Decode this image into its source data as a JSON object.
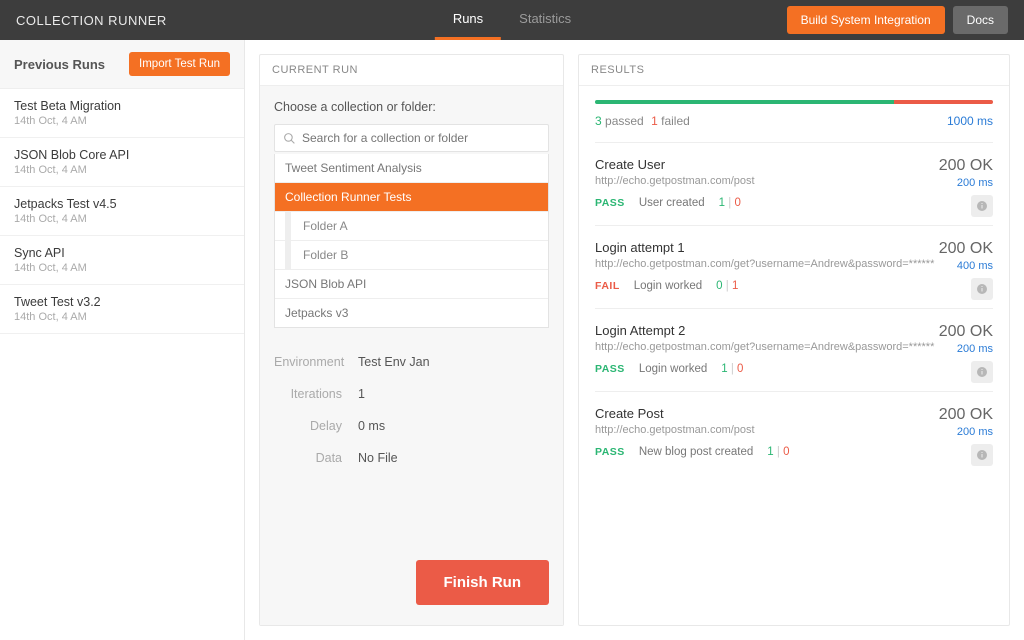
{
  "app_title": "COLLECTION RUNNER",
  "tabs": {
    "runs": "Runs",
    "statistics": "Statistics"
  },
  "header_buttons": {
    "build": "Build System Integration",
    "docs": "Docs"
  },
  "sidebar": {
    "title": "Previous Runs",
    "import_btn": "Import Test Run",
    "items": [
      {
        "name": "Test Beta Migration",
        "time": "14th Oct, 4 AM"
      },
      {
        "name": "JSON Blob Core API",
        "time": "14th Oct, 4 AM"
      },
      {
        "name": "Jetpacks Test v4.5",
        "time": "14th Oct, 4 AM"
      },
      {
        "name": "Sync API",
        "time": "14th Oct, 4 AM"
      },
      {
        "name": "Tweet Test v3.2",
        "time": "14th Oct, 4 AM"
      }
    ]
  },
  "current_run": {
    "panel_title": "CURRENT RUN",
    "prompt": "Choose a collection or folder:",
    "search_placeholder": "Search for a collection or folder",
    "collections": [
      {
        "label": "Tweet Sentiment Analysis",
        "type": "coll",
        "selected": false
      },
      {
        "label": "Collection Runner Tests",
        "type": "coll",
        "selected": true
      },
      {
        "label": "Folder A",
        "type": "folder",
        "selected": false
      },
      {
        "label": "Folder B",
        "type": "folder",
        "selected": false
      },
      {
        "label": "JSON Blob API",
        "type": "coll",
        "selected": false
      },
      {
        "label": "Jetpacks v3",
        "type": "coll",
        "selected": false
      }
    ],
    "params": {
      "env_label": "Environment",
      "env_value": "Test Env Jan",
      "iter_label": "Iterations",
      "iter_value": "1",
      "delay_label": "Delay",
      "delay_value": "0  ms",
      "data_label": "Data",
      "data_value": "No File"
    },
    "finish_btn": "Finish Run"
  },
  "results": {
    "panel_title": "RESULTS",
    "passed_count": "3",
    "passed_label": "passed",
    "failed_count": "1",
    "failed_label": "failed",
    "total_ms": "1000 ms",
    "requests": [
      {
        "name": "Create User",
        "url": "http://echo.getpostman.com/post",
        "status": "200 OK",
        "ms": "200 ms",
        "assert_status": "PASS",
        "assert_msg": "User created",
        "pass": "1",
        "fail": "0"
      },
      {
        "name": "Login attempt 1",
        "url": "http://echo.getpostman.com/get?username=Andrew&password=******",
        "status": "200 OK",
        "ms": "400 ms",
        "assert_status": "FAIL",
        "assert_msg": "Login worked",
        "pass": "0",
        "fail": "1"
      },
      {
        "name": "Login Attempt 2",
        "url": "http://echo.getpostman.com/get?username=Andrew&password=******",
        "status": "200 OK",
        "ms": "200 ms",
        "assert_status": "PASS",
        "assert_msg": "Login worked",
        "pass": "1",
        "fail": "0"
      },
      {
        "name": "Create Post",
        "url": "http://echo.getpostman.com/post",
        "status": "200 OK",
        "ms": "200 ms",
        "assert_status": "PASS",
        "assert_msg": "New blog post created",
        "pass": "1",
        "fail": "0"
      }
    ]
  }
}
